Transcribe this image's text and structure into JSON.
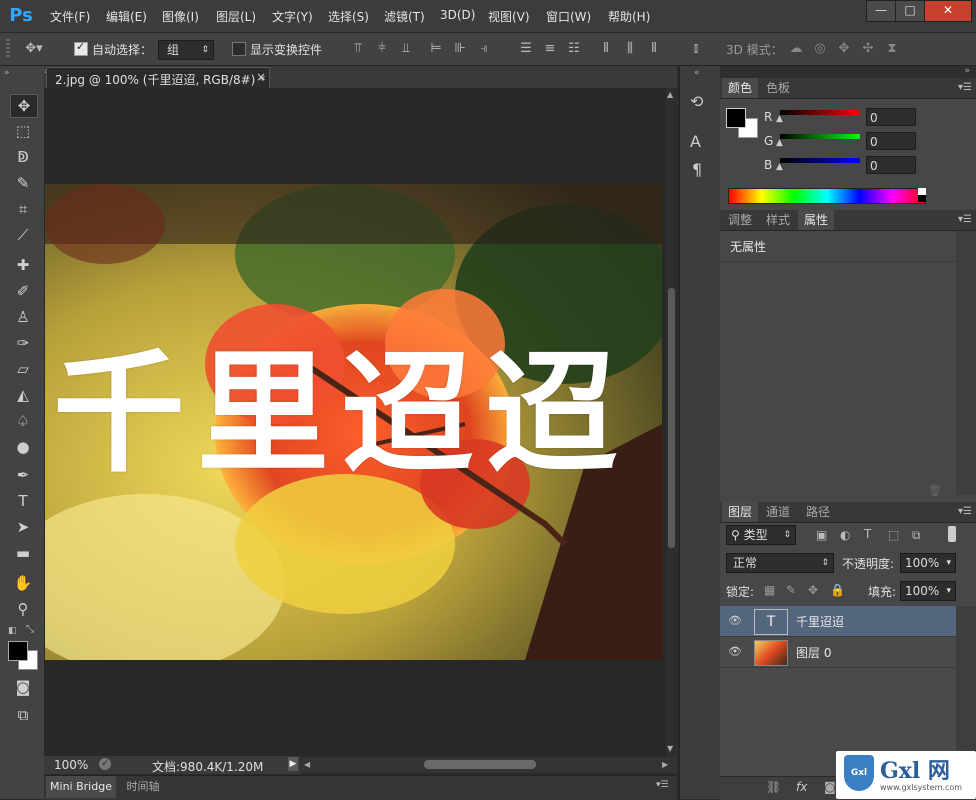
{
  "app": {
    "logo": "Ps"
  },
  "menu": [
    "文件(F)",
    "编辑(E)",
    "图像(I)",
    "图层(L)",
    "文字(Y)",
    "选择(S)",
    "滤镜(T)",
    "3D(D)",
    "视图(V)",
    "窗口(W)",
    "帮助(H)"
  ],
  "window_controls": {
    "minimize": "—",
    "maximize": "□",
    "close": "✕"
  },
  "options": {
    "auto_select_label": "自动选择：",
    "auto_select_value": "组",
    "show_transform_label": "显示变换控件",
    "mode_3d_label": "3D 模式："
  },
  "document": {
    "tab_title": "2.jpg @ 100% (千里迢迢, RGB/8#) *",
    "tab_close": "×",
    "overlay_text": "千里迢迢",
    "zoom": "100%",
    "doc_size": "文档:980.4K/1.20M"
  },
  "bottom_tabs": [
    "Mini Bridge",
    "时间轴"
  ],
  "color_panel": {
    "tabs": [
      "颜色",
      "色板"
    ],
    "channels": [
      {
        "label": "R",
        "value": "0"
      },
      {
        "label": "G",
        "value": "0"
      },
      {
        "label": "B",
        "value": "0"
      }
    ]
  },
  "adjust_panel": {
    "tabs": [
      "调整",
      "样式",
      "属性"
    ],
    "content": "无属性"
  },
  "layers_panel": {
    "tabs": [
      "图层",
      "通道",
      "路径"
    ],
    "filter_label": "类型",
    "blend_mode": "正常",
    "opacity_label": "不透明度:",
    "opacity_value": "100%",
    "lock_label": "锁定:",
    "fill_label": "填充:",
    "fill_value": "100%",
    "layers": [
      {
        "name": "千里迢迢",
        "kind": "text",
        "thumb": "T"
      },
      {
        "name": "图层 0",
        "kind": "image"
      }
    ],
    "footer_fx": "fx"
  },
  "watermark": {
    "brand": "Gxl 网",
    "url": "www.gxlsystem.com",
    "badge": "Gxl"
  },
  "colors": {
    "accent": "#31a8ff",
    "selected_layer": "#54657e"
  }
}
